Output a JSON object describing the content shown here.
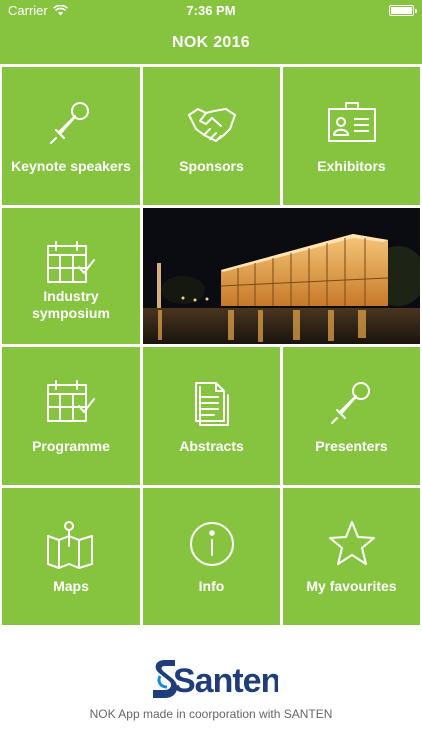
{
  "status_bar": {
    "carrier": "Carrier",
    "time": "7:36 PM"
  },
  "nav": {
    "title": "NOK 2016"
  },
  "tiles": [
    {
      "label": "Keynote speakers",
      "icon": "microphone-icon"
    },
    {
      "label": "Sponsors",
      "icon": "handshake-icon"
    },
    {
      "label": "Exhibitors",
      "icon": "id-card-icon"
    },
    {
      "label": "Industry symposium",
      "icon": "calendar-check-icon"
    },
    {
      "label": "Programme",
      "icon": "calendar-check-icon"
    },
    {
      "label": "Abstracts",
      "icon": "documents-icon"
    },
    {
      "label": "Presenters",
      "icon": "microphone-icon"
    },
    {
      "label": "Maps",
      "icon": "map-pin-icon"
    },
    {
      "label": "Info",
      "icon": "info-icon"
    },
    {
      "label": "My favourites",
      "icon": "star-icon"
    }
  ],
  "footer": {
    "logo_text": "Santen",
    "note": "NOK App made in coorporation with SANTEN"
  },
  "colors": {
    "brand_green": "#86c440",
    "logo_blue": "#1f3d7a",
    "white": "#ffffff"
  }
}
